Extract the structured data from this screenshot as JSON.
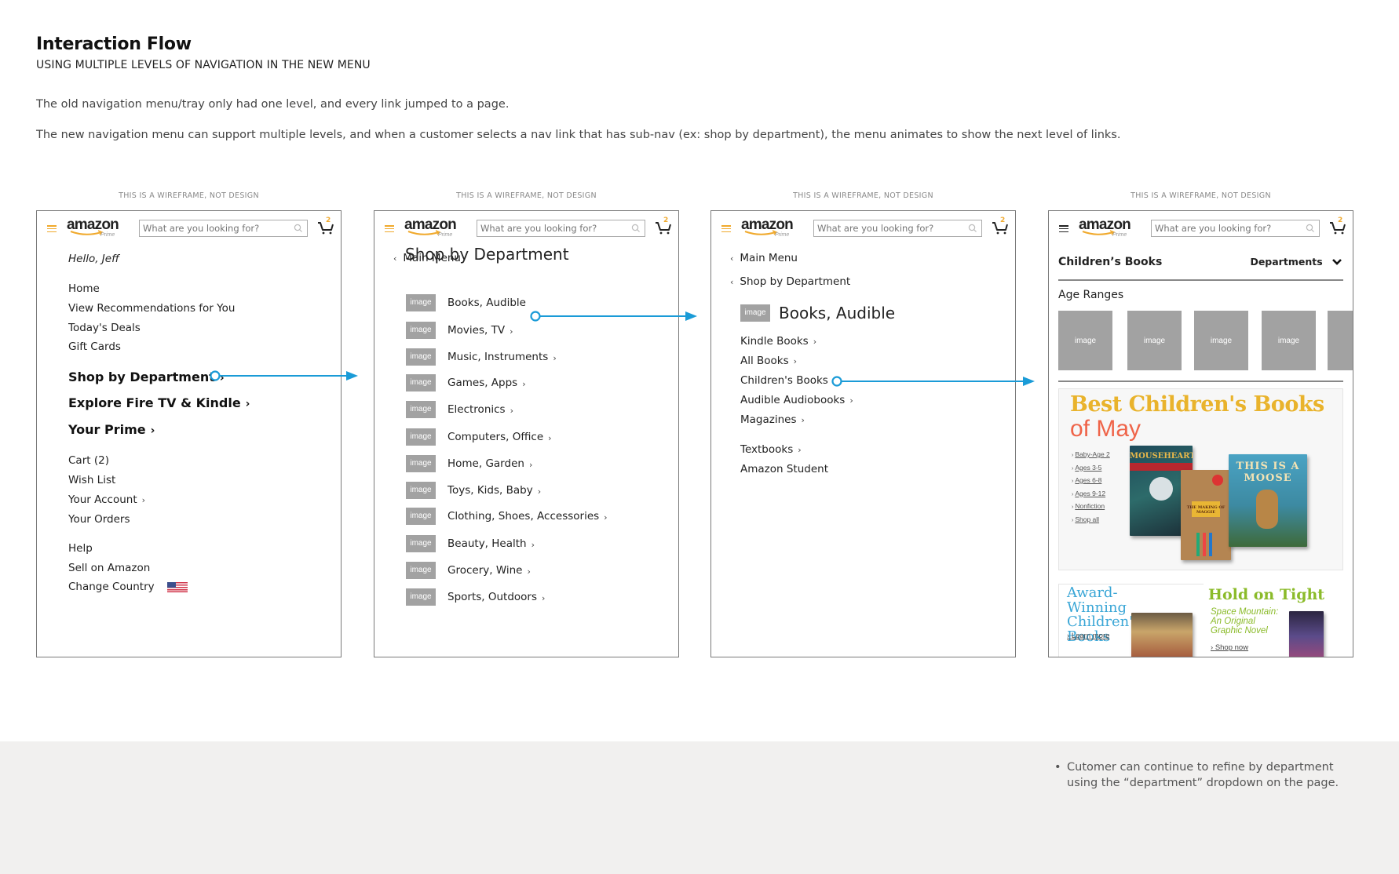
{
  "header": {
    "title": "Interaction Flow",
    "subtitle": "USING MULTIPLE LEVELS OF NAVIGATION IN THE NEW MENU"
  },
  "intro": {
    "paragraph_1": "The old navigation menu/tray only had one level, and every link jumped to a page.",
    "paragraph_2": "The new navigation menu can support multiple levels, and when a customer selects a nav link that has sub-nav (ex: shop by department), the menu animates to show the next level of links."
  },
  "wireframe_label": "THIS IS A WIREFRAME, NOT DESIGN",
  "app_header": {
    "logo": "amazon",
    "logo_sub": "Prime",
    "search_placeholder": "What are you looking for?",
    "cart_count": "2",
    "icons": [
      "hamburger-menu-icon",
      "search-icon",
      "cart-icon"
    ]
  },
  "colors": {
    "accent_orange": "#f0a92c",
    "flow_arrow": "#1a9bd7",
    "placeholder_gray": "#a2a2a2",
    "footer_bg": "#f1f0ef"
  },
  "panel_1": {
    "greeting": "Hello, Jeff",
    "group_1": [
      "Home",
      "View Recommendations for You",
      "Today's Deals",
      "Gift Cards"
    ],
    "group_2": [
      {
        "label": "Shop by Department",
        "chevron": "›"
      },
      {
        "label": "Explore Fire TV & Kindle",
        "chevron": "›"
      },
      {
        "label": "Your Prime",
        "chevron": "›"
      }
    ],
    "group_3": [
      {
        "label": "Cart (2)",
        "chevron": ""
      },
      {
        "label": "Wish List",
        "chevron": ""
      },
      {
        "label": "Your Account",
        "chevron": "›"
      },
      {
        "label": "Your Orders",
        "chevron": ""
      }
    ],
    "group_4": [
      "Help",
      "Sell on Amazon",
      "Change Country"
    ],
    "flag_icon": "us-flag-icon"
  },
  "panel_2": {
    "back_label": "Main Menu",
    "title": "Shop by Department",
    "image_placeholder": "image",
    "departments": [
      {
        "label": "Books, Audible",
        "chevron": ""
      },
      {
        "label": "Movies, TV",
        "chevron": "›"
      },
      {
        "label": "Music, Instruments",
        "chevron": "›"
      },
      {
        "label": "Games, Apps",
        "chevron": "›"
      },
      {
        "label": "Electronics",
        "chevron": "›"
      },
      {
        "label": "Computers, Office",
        "chevron": "›"
      },
      {
        "label": "Home, Garden",
        "chevron": "›"
      },
      {
        "label": "Toys, Kids, Baby",
        "chevron": "›"
      },
      {
        "label": "Clothing, Shoes, Accessories",
        "chevron": "›"
      },
      {
        "label": "Beauty, Health",
        "chevron": "›"
      },
      {
        "label": "Grocery, Wine",
        "chevron": "›"
      },
      {
        "label": "Sports, Outdoors",
        "chevron": "›"
      }
    ]
  },
  "panel_3": {
    "back_main": "Main Menu",
    "back_dept": "Shop by Department",
    "image_placeholder": "image",
    "title": "Books, Audible",
    "links_1": [
      {
        "label": "Kindle Books",
        "chevron": "›"
      },
      {
        "label": "All Books",
        "chevron": "›"
      },
      {
        "label": "Children's Books",
        "chevron": "›"
      },
      {
        "label": "Audible Audiobooks",
        "chevron": "›"
      },
      {
        "label": "Magazines",
        "chevron": "›"
      }
    ],
    "links_2": [
      {
        "label": "Textbooks",
        "chevron": "›"
      },
      {
        "label": "Amazon Student",
        "chevron": ""
      }
    ]
  },
  "panel_4": {
    "title": "Children’s Books",
    "departments_dropdown": "Departments",
    "age_ranges_label": "Age Ranges",
    "age_tiles": [
      "image",
      "image",
      "image",
      "image",
      ""
    ],
    "banner": {
      "headline": "Best Children's Books",
      "headline_2": "of May",
      "links": [
        "Baby-Age 2",
        "Ages 3-5",
        "Ages 6-8",
        "Ages 9-12",
        "Nonfiction",
        "Shop all"
      ],
      "books": [
        "MOUSEHEART",
        "THE MAKING OF MAGGIE",
        "THIS IS A MOOSE"
      ]
    },
    "promo_left": {
      "headline": "Award-Winning Children's Books",
      "link": "Learn more"
    },
    "promo_right": {
      "headline": "Hold on Tight",
      "subtitle": "Space Mountain: An Original Graphic Novel",
      "link": "Shop now"
    }
  },
  "footer": {
    "notes": [
      "Cutomer can continue to refine by department using the “department” dropdown on the page."
    ],
    "note_line_1": "Cutomer can continue to refine by department",
    "note_line_2": "using the “department” dropdown on the page."
  }
}
